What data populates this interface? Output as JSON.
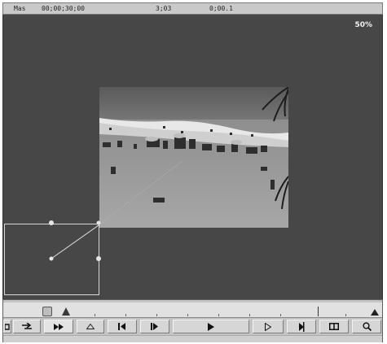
{
  "info_bar": {
    "label": "Mas",
    "timecode_current": "00;00;30;00",
    "timecode_duration": "3;03",
    "timecode_offset": "0;00.1"
  },
  "viewer": {
    "zoom": "50%"
  },
  "transport": {
    "buttons": [
      {
        "name": "snap-button",
        "icon": "snap-icon"
      },
      {
        "name": "swap-button",
        "icon": "swap-arrows-icon"
      },
      {
        "name": "fast-forward-button",
        "icon": "fast-forward-icon"
      },
      {
        "name": "keyframe-button",
        "icon": "triangle-outline-icon"
      },
      {
        "name": "step-back-button",
        "icon": "step-back-icon"
      },
      {
        "name": "step-forward-button",
        "icon": "step-forward-icon"
      },
      {
        "name": "play-button",
        "icon": "play-icon"
      },
      {
        "name": "play-out-button",
        "icon": "play-outline-icon"
      },
      {
        "name": "play-to-end-button",
        "icon": "play-to-end-icon"
      },
      {
        "name": "split-view-button",
        "icon": "split-view-icon"
      },
      {
        "name": "zoom-button",
        "icon": "magnifier-icon"
      }
    ]
  },
  "colors": {
    "viewer_bg": "#474747",
    "panel_bg": "#c4c4c4",
    "outline": "#d8d8d8"
  }
}
